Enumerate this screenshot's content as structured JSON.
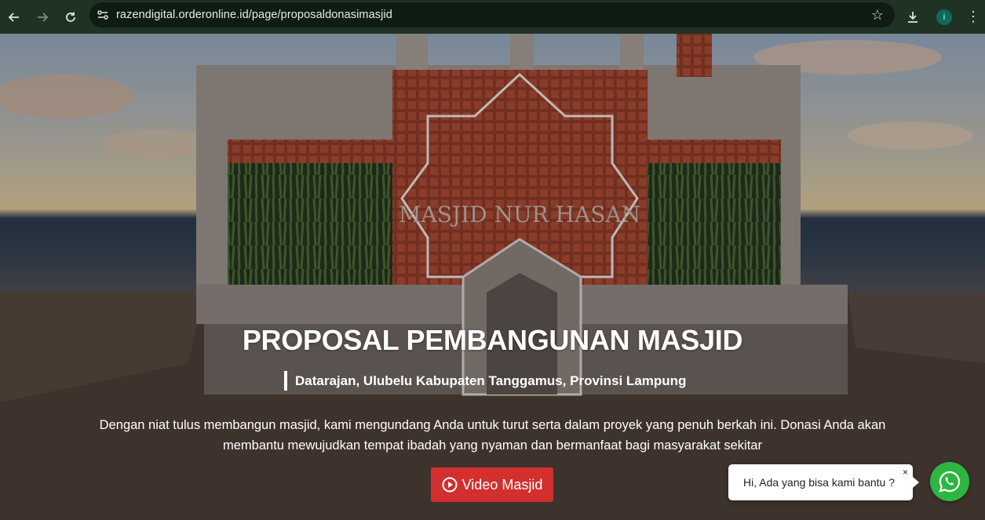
{
  "browser": {
    "url": "razendigital.orderonline.id/page/proposaldonasimasjid",
    "profile_initial": "i"
  },
  "hero": {
    "building_sign": "MASJID NUR HASAN",
    "title": "PROPOSAL PEMBANGUNAN MASJID",
    "location": "Datarajan, Ulubelu Kabupaten Tanggamus, Provinsi Lampung",
    "description_line1": "Dengan niat tulus membangun masjid, kami mengundang Anda untuk turut serta dalam proyek yang penuh berkah ini. Donasi Anda akan",
    "description_line2": "membantu mewujudkan tempat ibadah yang nyaman dan bermanfaat bagi masyarakat sekitar",
    "video_button": "Video Masjid"
  },
  "chat": {
    "message": "Hi, Ada yang bisa kami bantu ?",
    "close_label": "×"
  },
  "colors": {
    "chrome_bg": "#1e3324",
    "button_red": "#d32f2f",
    "whatsapp_green": "#2db742"
  }
}
